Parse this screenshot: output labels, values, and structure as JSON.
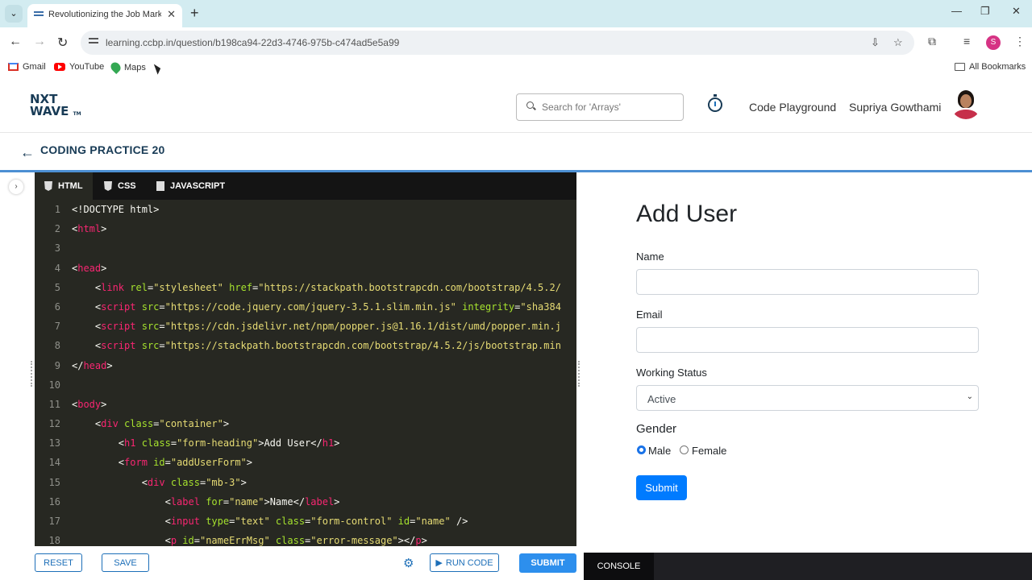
{
  "browser": {
    "tab_title": "Revolutionizing the Job Market",
    "tab_close": "✕",
    "new_tab": "+",
    "url": "learning.ccbp.in/question/b198ca94-22d3-4746-975b-c474ad5e5a99",
    "profile_initial": "S",
    "bookmarks": [
      "Gmail",
      "YouTube",
      "Maps"
    ],
    "all_bookmarks": "All Bookmarks"
  },
  "header": {
    "logo_line1": "NXT",
    "logo_line2": "WAVE",
    "logo_tm": "TM",
    "search_placeholder": "Search for 'Arrays'",
    "code_playground": "Code Playground",
    "user_name": "Supriya Gowthami"
  },
  "practice": {
    "title": "CODING PRACTICE 20"
  },
  "editor": {
    "tabs": [
      "HTML",
      "CSS",
      "JAVASCRIPT"
    ],
    "line_numbers": [
      "1",
      "2",
      "3",
      "4",
      "5",
      "6",
      "7",
      "8",
      "9",
      "10",
      "11",
      "12",
      "13",
      "14",
      "15",
      "16",
      "17",
      "18"
    ]
  },
  "buttons": {
    "reset": "RESET",
    "save": "SAVE",
    "run_code": "RUN CODE",
    "submit": "SUBMIT"
  },
  "preview": {
    "heading": "Add User",
    "name_label": "Name",
    "email_label": "Email",
    "status_label": "Working Status",
    "status_value": "Active",
    "gender_label": "Gender",
    "male": "Male",
    "female": "Female",
    "submit": "Submit"
  },
  "console": {
    "tab": "CONSOLE"
  },
  "colors": {
    "accent": "#1d6fb8",
    "primary": "#007bff",
    "editor_bg": "#272822"
  }
}
